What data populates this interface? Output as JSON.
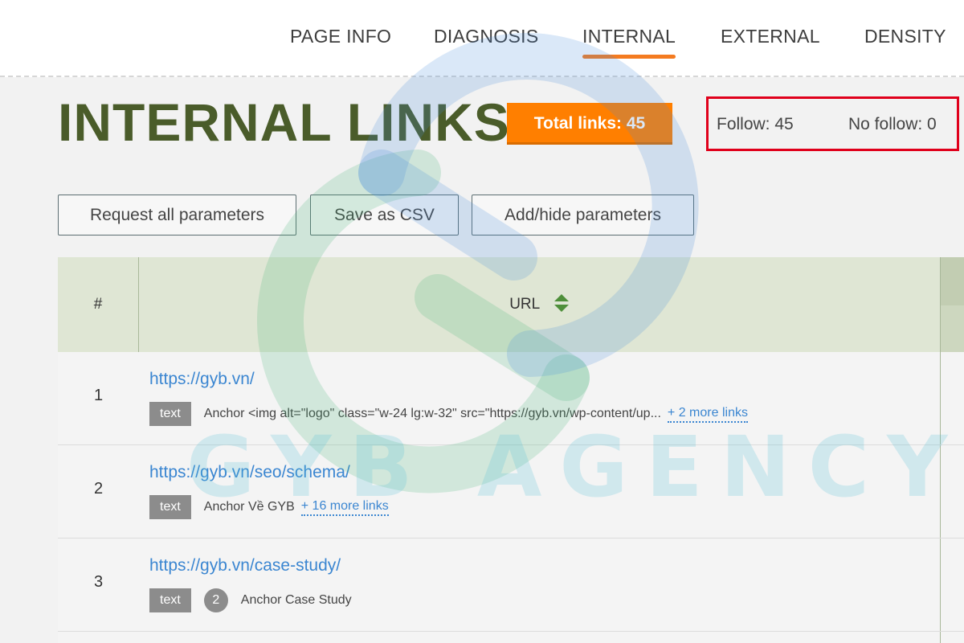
{
  "nav": {
    "tabs": [
      {
        "label": "PAGE INFO",
        "active": false
      },
      {
        "label": "DIAGNOSIS",
        "active": false
      },
      {
        "label": "INTERNAL",
        "active": true
      },
      {
        "label": "EXTERNAL",
        "active": false
      },
      {
        "label": "DENSITY",
        "active": false
      }
    ]
  },
  "header": {
    "title": "INTERNAL LINKS",
    "total_links": "Total links: 45",
    "follow": "Follow: 45",
    "no_follow": "No follow: 0"
  },
  "toolbar": {
    "request_label": "Request all parameters",
    "csv_label": "Save as CSV",
    "addhide_label": "Add/hide parameters"
  },
  "table": {
    "columns": [
      "#",
      "URL"
    ],
    "rows": [
      {
        "num": "1",
        "url": "https://gyb.vn/",
        "tag": "text",
        "anchor": "Anchor <img alt=\"logo\" class=\"w-24 lg:w-32\" src=\"https://gyb.vn/wp-content/up...",
        "more": "+ 2 more links"
      },
      {
        "num": "2",
        "url": "https://gyb.vn/seo/schema/",
        "tag": "text",
        "anchor": "Anchor Về GYB",
        "more": "+ 16 more links"
      },
      {
        "num": "3",
        "url": "https://gyb.vn/case-study/",
        "tag": "text",
        "count": "2",
        "anchor": "Anchor Case Study"
      }
    ]
  },
  "watermark": {
    "text": "GYB AGENCY"
  },
  "colors": {
    "accent": "#f47b20",
    "title": "#4a5c2a",
    "badge": "#ff7f00",
    "highlight_border": "#e0001b",
    "link": "#3b86d1",
    "header_bg": "#dfe6d4",
    "sort_icon": "#4e8f3a"
  }
}
